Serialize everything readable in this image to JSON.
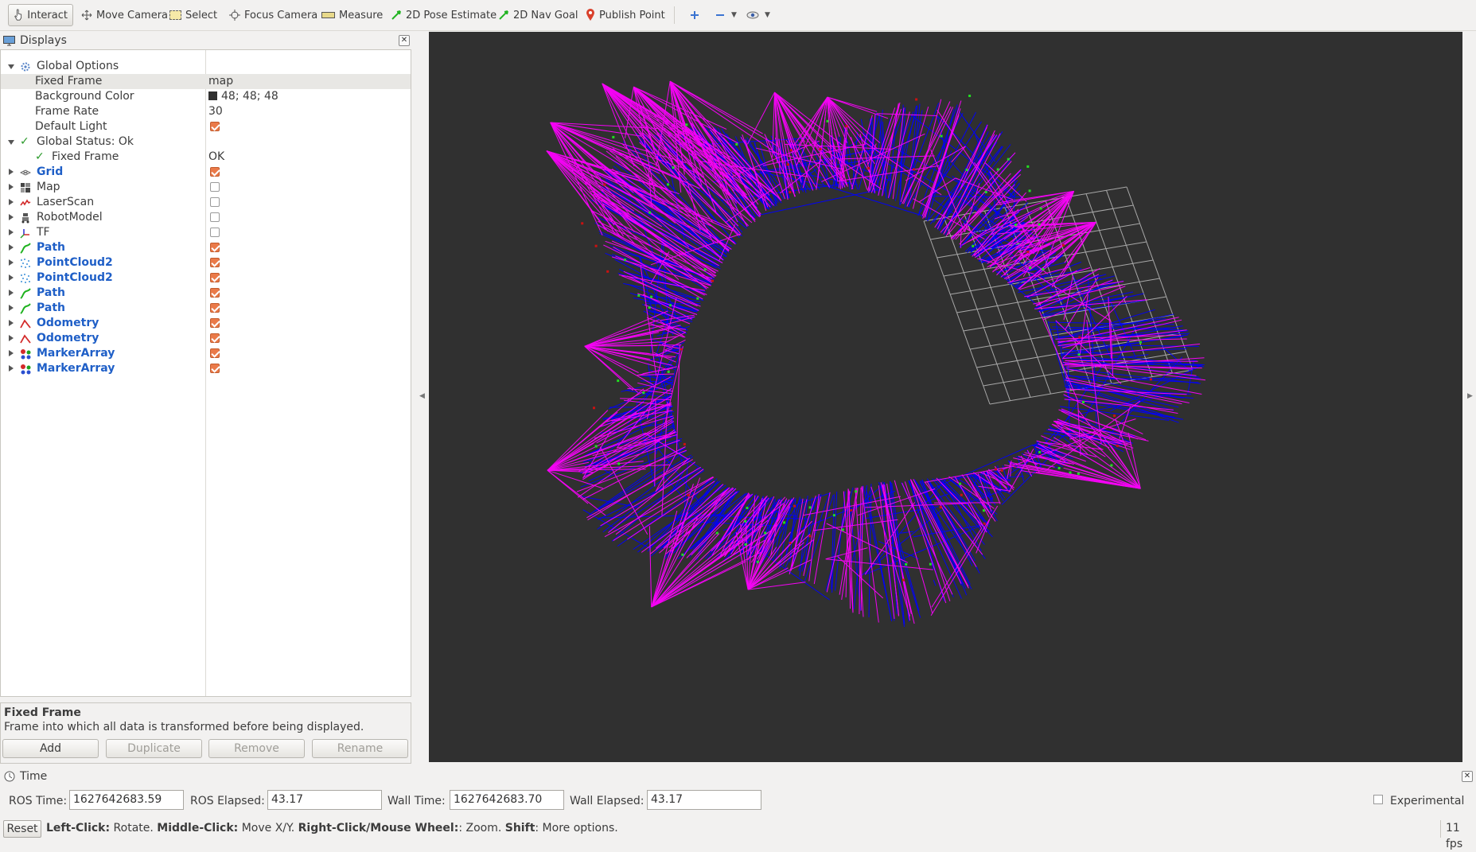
{
  "toolbar": {
    "interact": "Interact",
    "move_camera": "Move Camera",
    "select": "Select",
    "focus_camera": "Focus Camera",
    "measure": "Measure",
    "pose_estimate": "2D Pose Estimate",
    "nav_goal": "2D Nav Goal",
    "publish_point": "Publish Point"
  },
  "displays_panel": {
    "title": "Displays",
    "rows": [
      {
        "label": "Global Options"
      },
      {
        "label": "Fixed Frame",
        "value": "map"
      },
      {
        "label": "Background Color",
        "value": "48; 48; 48"
      },
      {
        "label": "Frame Rate",
        "value": "30"
      },
      {
        "label": "Default Light"
      },
      {
        "label": "Global Status: Ok"
      },
      {
        "label": "Fixed Frame",
        "value": "OK"
      },
      {
        "label": "Grid"
      },
      {
        "label": "Map"
      },
      {
        "label": "LaserScan"
      },
      {
        "label": "RobotModel"
      },
      {
        "label": "TF"
      },
      {
        "label": "Path"
      },
      {
        "label": "PointCloud2"
      },
      {
        "label": "PointCloud2"
      },
      {
        "label": "Path"
      },
      {
        "label": "Path"
      },
      {
        "label": "Odometry"
      },
      {
        "label": "Odometry"
      },
      {
        "label": "MarkerArray"
      },
      {
        "label": "MarkerArray"
      }
    ],
    "description_title": "Fixed Frame",
    "description_body": "Frame into which all data is transformed before being displayed.",
    "buttons": {
      "add": "Add",
      "duplicate": "Duplicate",
      "remove": "Remove",
      "rename": "Rename"
    }
  },
  "viewport": {
    "background_color": "#303030",
    "edge_color_a": "#0000ff",
    "edge_color_b": "#ff00ff"
  },
  "time_panel": {
    "title": "Time",
    "ros_time_label": "ROS Time:",
    "ros_time": "1627642683.59",
    "ros_elapsed_label": "ROS Elapsed:",
    "ros_elapsed": "43.17",
    "wall_time_label": "Wall Time:",
    "wall_time": "1627642683.70",
    "wall_elapsed_label": "Wall Elapsed:",
    "wall_elapsed": "43.17",
    "experimental_label": "Experimental"
  },
  "status": {
    "reset": "Reset",
    "left_click": "Left-Click:",
    "left_click_desc": " Rotate. ",
    "middle_click": "Middle-Click:",
    "middle_click_desc": " Move X/Y. ",
    "right_click": "Right-Click/Mouse Wheel:",
    "right_click_desc": ": Zoom. ",
    "shift": "Shift",
    "shift_desc": ": More options.",
    "fps": "11 fps"
  }
}
